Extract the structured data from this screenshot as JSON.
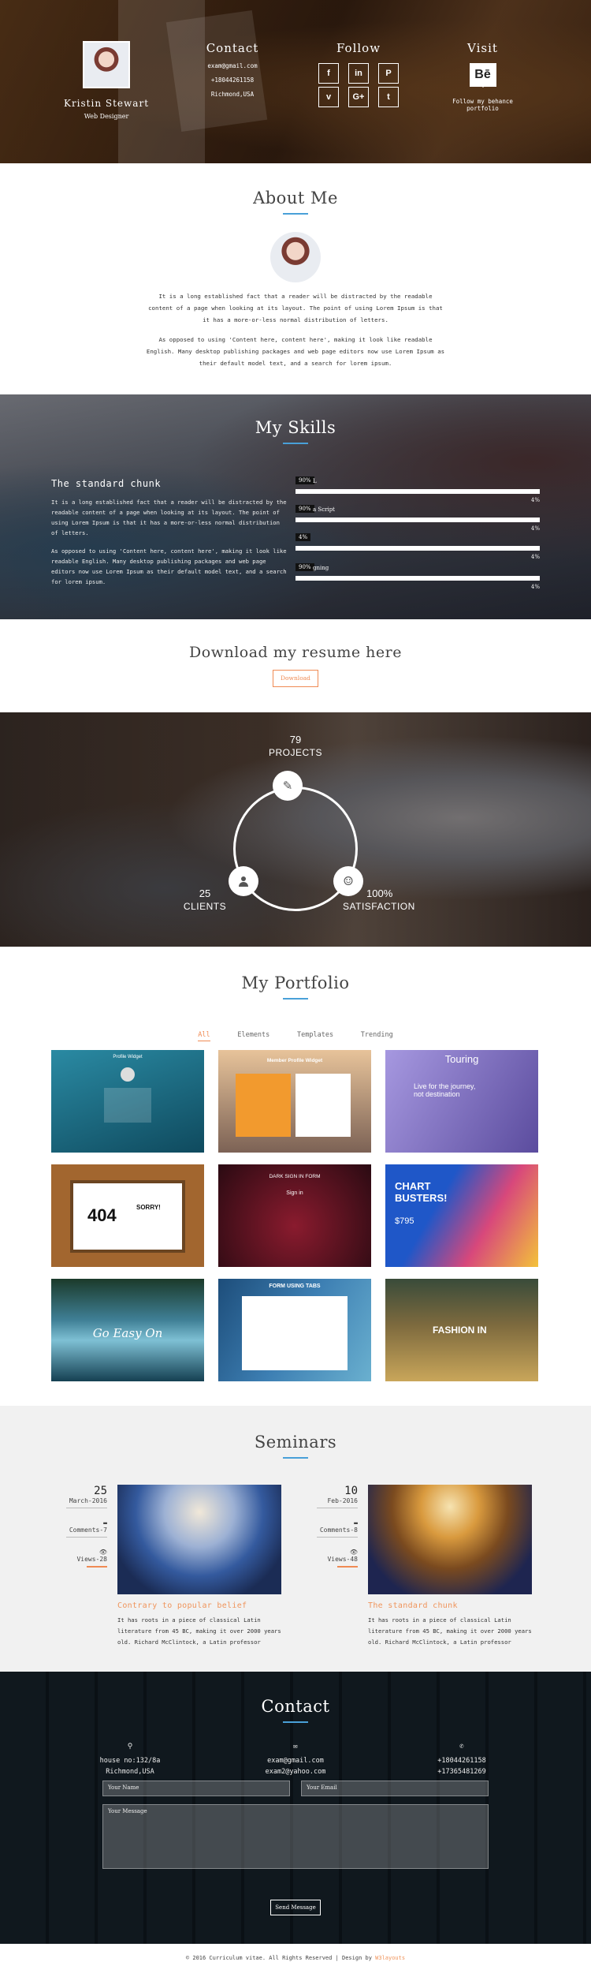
{
  "header": {
    "name": "Kristin Stewart",
    "role": "Web Designer",
    "contact_title": "Contact",
    "contact_lines": [
      "exam@gmail.com",
      "+18044261158",
      "Richmond,USA"
    ],
    "follow_title": "Follow",
    "social": [
      {
        "icon": "facebook-icon",
        "glyph": "f"
      },
      {
        "icon": "linkedin-icon",
        "glyph": "in"
      },
      {
        "icon": "pinterest-icon",
        "glyph": "P"
      },
      {
        "icon": "vimeo-icon",
        "glyph": "v"
      },
      {
        "icon": "google-plus-icon",
        "glyph": "G+"
      },
      {
        "icon": "tumblr-icon",
        "glyph": "t"
      }
    ],
    "visit_title": "Visit",
    "behance_glyph": "Bē",
    "visit_text_1": "Follow my behance",
    "visit_text_2": "portfolio"
  },
  "about": {
    "title": "About Me",
    "para1": "It is a long established fact that a reader will be distracted by the readable content of a page when looking at its layout. The point of using Lorem Ipsum is that it has a more-or-less normal distribution of letters.",
    "para2": "As opposed to using 'Content here, content here', making it look like readable English. Many desktop publishing packages and web page editors now use Lorem Ipsum as their default model text, and a search for lorem ipsum."
  },
  "skills": {
    "title": "My Skills",
    "heading": "The standard chunk",
    "para1": "It is a long established fact that a reader will be distracted by the readable content of a page when looking at its layout. The point of using Lorem Ipsum is that it has a more-or-less normal distribution of letters.",
    "para2": "As opposed to using 'Content here, content here', making it look like readable English. Many desktop publishing packages and web page editors now use Lorem Ipsum as their default model text, and a search for lorem ipsum.",
    "bars": [
      {
        "tag": "90%",
        "label": "L",
        "pct": "4%",
        "value": 1.0
      },
      {
        "tag": "90%",
        "label": "a Script",
        "pct": "4%",
        "value": 1.0
      },
      {
        "tag": "4%",
        "label": "",
        "pct": "4%",
        "value": 1.0
      },
      {
        "tag": "90%",
        "label": "gning",
        "pct": "4%",
        "value": 1.0
      }
    ]
  },
  "resume": {
    "title": "Download my resume here",
    "button": "Download"
  },
  "stats": {
    "projects_num": "79",
    "projects_label": "PROJECTS",
    "clients_num": "25",
    "clients_label": "CLIENTS",
    "satisfaction_num": "100%",
    "satisfaction_label": "SATISFACTION",
    "icons": [
      "edit-icon",
      "user-icon",
      "smile-icon"
    ]
  },
  "portfolio": {
    "title": "My Portfolio",
    "tabs": [
      "All",
      "Elements",
      "Templates",
      "Trending"
    ],
    "active_tab": "All",
    "tiles": [
      {
        "title": "Profile Widget",
        "bg": "#1f6e86"
      },
      {
        "title": "Member Profile Widget",
        "bg": "#c8864a"
      },
      {
        "title": "Touring",
        "bg": "#8b7cc4"
      },
      {
        "title": "404",
        "bg": "#8f5b2e"
      },
      {
        "title": "DARK SIGN IN FORM",
        "bg": "#4a1420"
      },
      {
        "title": "CHART BUSTERS!",
        "bg": "#2f5fc6"
      },
      {
        "title": "Go Easy On",
        "bg": "#2c5f77"
      },
      {
        "title": "FORM USING TABS",
        "bg": "#3b6fa0"
      },
      {
        "title": "FASHION IN",
        "bg": "#8e7a4a"
      }
    ],
    "tile_texts": {
      "sorry": "SORRY!",
      "touring_sub": "Live for the journey, not destination",
      "price": "$795",
      "signin": "Sign in"
    }
  },
  "seminars": {
    "title": "Seminars",
    "events": [
      {
        "day": "25",
        "month": "March-2016",
        "comments": "Comments-7",
        "views": "Views-28",
        "title": "Contrary to popular belief",
        "text": "It has roots in a piece of classical Latin literature from 45 BC, making it over 2000 years old. Richard McClintock, a Latin professor"
      },
      {
        "day": "10",
        "month": "Feb-2016",
        "comments": "Comments-8",
        "views": "Views-48",
        "title": "The standard chunk",
        "text": "It has roots in a piece of classical Latin literature from 45 BC, making it over 2000 years old. Richard McClintock, a Latin professor"
      }
    ]
  },
  "contact": {
    "title": "Contact",
    "address_1": "house no:132/8a",
    "address_2": "Richmond,USA",
    "email_1": "exam@gmail.com",
    "email_2": "exam2@yahoo.com",
    "phone_1": "+18044261158",
    "phone_2": "+17365481269",
    "name_placeholder": "Your Name",
    "email_placeholder": "Your Email",
    "message_placeholder": "Your Message",
    "send": "Send Message"
  },
  "footer": {
    "text": "© 2016 Curriculum vitae. All Rights Reserved | Design by ",
    "link": "W3layouts"
  }
}
